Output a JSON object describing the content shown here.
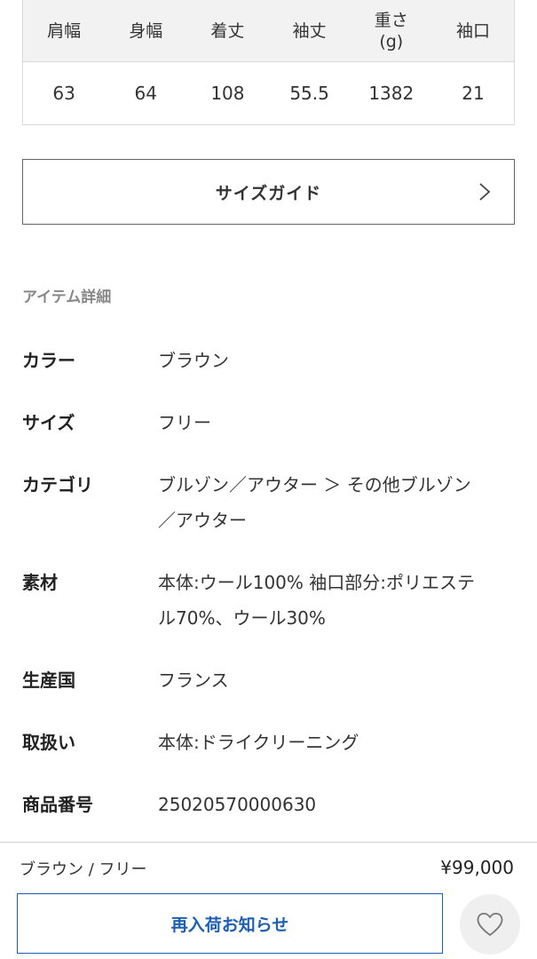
{
  "size_table": {
    "headers": [
      "肩幅",
      "身幅",
      "着丈",
      "袖丈",
      "重さ\n(g)",
      "袖口"
    ],
    "values": [
      "63",
      "64",
      "108",
      "55.5",
      "1382",
      "21"
    ]
  },
  "size_guide": {
    "label": "サイズガイド",
    "icon": "chevron-right-icon"
  },
  "item_details": {
    "title": "アイテム詳細",
    "rows": [
      {
        "key": "カラー",
        "value": "ブラウン"
      },
      {
        "key": "サイズ",
        "value": "フリー"
      },
      {
        "key": "カテゴリ",
        "value_lines": [
          "ブルゾン／アウター ＞ その他ブルゾン",
          "／アウター"
        ]
      },
      {
        "key": "素材",
        "value_lines": [
          "本体:ウール100% 袖口部分:ポリエステ",
          "ル70%、ウール30%"
        ]
      },
      {
        "key": "生産国",
        "value": "フランス"
      },
      {
        "key": "取扱い",
        "value": "本体:ドライクリーニング"
      },
      {
        "key": "商品番号",
        "value": "25020570000630"
      }
    ]
  },
  "purchase_bar": {
    "variant": "ブラウン / フリー",
    "price": "¥99,000",
    "restock_label": "再入荷お知らせ",
    "favorite_icon": "heart-icon",
    "accent_color": "#1d5fb4"
  }
}
